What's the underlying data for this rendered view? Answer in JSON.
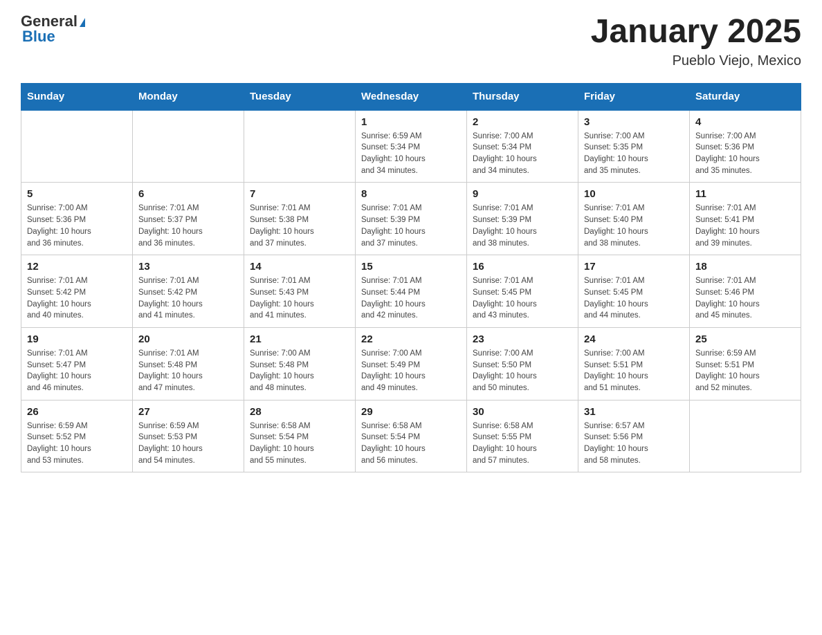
{
  "header": {
    "logo_general": "General",
    "logo_blue": "Blue",
    "month": "January 2025",
    "location": "Pueblo Viejo, Mexico"
  },
  "days_of_week": [
    "Sunday",
    "Monday",
    "Tuesday",
    "Wednesday",
    "Thursday",
    "Friday",
    "Saturday"
  ],
  "weeks": [
    [
      {
        "day": "",
        "info": ""
      },
      {
        "day": "",
        "info": ""
      },
      {
        "day": "",
        "info": ""
      },
      {
        "day": "1",
        "info": "Sunrise: 6:59 AM\nSunset: 5:34 PM\nDaylight: 10 hours\nand 34 minutes."
      },
      {
        "day": "2",
        "info": "Sunrise: 7:00 AM\nSunset: 5:34 PM\nDaylight: 10 hours\nand 34 minutes."
      },
      {
        "day": "3",
        "info": "Sunrise: 7:00 AM\nSunset: 5:35 PM\nDaylight: 10 hours\nand 35 minutes."
      },
      {
        "day": "4",
        "info": "Sunrise: 7:00 AM\nSunset: 5:36 PM\nDaylight: 10 hours\nand 35 minutes."
      }
    ],
    [
      {
        "day": "5",
        "info": "Sunrise: 7:00 AM\nSunset: 5:36 PM\nDaylight: 10 hours\nand 36 minutes."
      },
      {
        "day": "6",
        "info": "Sunrise: 7:01 AM\nSunset: 5:37 PM\nDaylight: 10 hours\nand 36 minutes."
      },
      {
        "day": "7",
        "info": "Sunrise: 7:01 AM\nSunset: 5:38 PM\nDaylight: 10 hours\nand 37 minutes."
      },
      {
        "day": "8",
        "info": "Sunrise: 7:01 AM\nSunset: 5:39 PM\nDaylight: 10 hours\nand 37 minutes."
      },
      {
        "day": "9",
        "info": "Sunrise: 7:01 AM\nSunset: 5:39 PM\nDaylight: 10 hours\nand 38 minutes."
      },
      {
        "day": "10",
        "info": "Sunrise: 7:01 AM\nSunset: 5:40 PM\nDaylight: 10 hours\nand 38 minutes."
      },
      {
        "day": "11",
        "info": "Sunrise: 7:01 AM\nSunset: 5:41 PM\nDaylight: 10 hours\nand 39 minutes."
      }
    ],
    [
      {
        "day": "12",
        "info": "Sunrise: 7:01 AM\nSunset: 5:42 PM\nDaylight: 10 hours\nand 40 minutes."
      },
      {
        "day": "13",
        "info": "Sunrise: 7:01 AM\nSunset: 5:42 PM\nDaylight: 10 hours\nand 41 minutes."
      },
      {
        "day": "14",
        "info": "Sunrise: 7:01 AM\nSunset: 5:43 PM\nDaylight: 10 hours\nand 41 minutes."
      },
      {
        "day": "15",
        "info": "Sunrise: 7:01 AM\nSunset: 5:44 PM\nDaylight: 10 hours\nand 42 minutes."
      },
      {
        "day": "16",
        "info": "Sunrise: 7:01 AM\nSunset: 5:45 PM\nDaylight: 10 hours\nand 43 minutes."
      },
      {
        "day": "17",
        "info": "Sunrise: 7:01 AM\nSunset: 5:45 PM\nDaylight: 10 hours\nand 44 minutes."
      },
      {
        "day": "18",
        "info": "Sunrise: 7:01 AM\nSunset: 5:46 PM\nDaylight: 10 hours\nand 45 minutes."
      }
    ],
    [
      {
        "day": "19",
        "info": "Sunrise: 7:01 AM\nSunset: 5:47 PM\nDaylight: 10 hours\nand 46 minutes."
      },
      {
        "day": "20",
        "info": "Sunrise: 7:01 AM\nSunset: 5:48 PM\nDaylight: 10 hours\nand 47 minutes."
      },
      {
        "day": "21",
        "info": "Sunrise: 7:00 AM\nSunset: 5:48 PM\nDaylight: 10 hours\nand 48 minutes."
      },
      {
        "day": "22",
        "info": "Sunrise: 7:00 AM\nSunset: 5:49 PM\nDaylight: 10 hours\nand 49 minutes."
      },
      {
        "day": "23",
        "info": "Sunrise: 7:00 AM\nSunset: 5:50 PM\nDaylight: 10 hours\nand 50 minutes."
      },
      {
        "day": "24",
        "info": "Sunrise: 7:00 AM\nSunset: 5:51 PM\nDaylight: 10 hours\nand 51 minutes."
      },
      {
        "day": "25",
        "info": "Sunrise: 6:59 AM\nSunset: 5:51 PM\nDaylight: 10 hours\nand 52 minutes."
      }
    ],
    [
      {
        "day": "26",
        "info": "Sunrise: 6:59 AM\nSunset: 5:52 PM\nDaylight: 10 hours\nand 53 minutes."
      },
      {
        "day": "27",
        "info": "Sunrise: 6:59 AM\nSunset: 5:53 PM\nDaylight: 10 hours\nand 54 minutes."
      },
      {
        "day": "28",
        "info": "Sunrise: 6:58 AM\nSunset: 5:54 PM\nDaylight: 10 hours\nand 55 minutes."
      },
      {
        "day": "29",
        "info": "Sunrise: 6:58 AM\nSunset: 5:54 PM\nDaylight: 10 hours\nand 56 minutes."
      },
      {
        "day": "30",
        "info": "Sunrise: 6:58 AM\nSunset: 5:55 PM\nDaylight: 10 hours\nand 57 minutes."
      },
      {
        "day": "31",
        "info": "Sunrise: 6:57 AM\nSunset: 5:56 PM\nDaylight: 10 hours\nand 58 minutes."
      },
      {
        "day": "",
        "info": ""
      }
    ]
  ]
}
